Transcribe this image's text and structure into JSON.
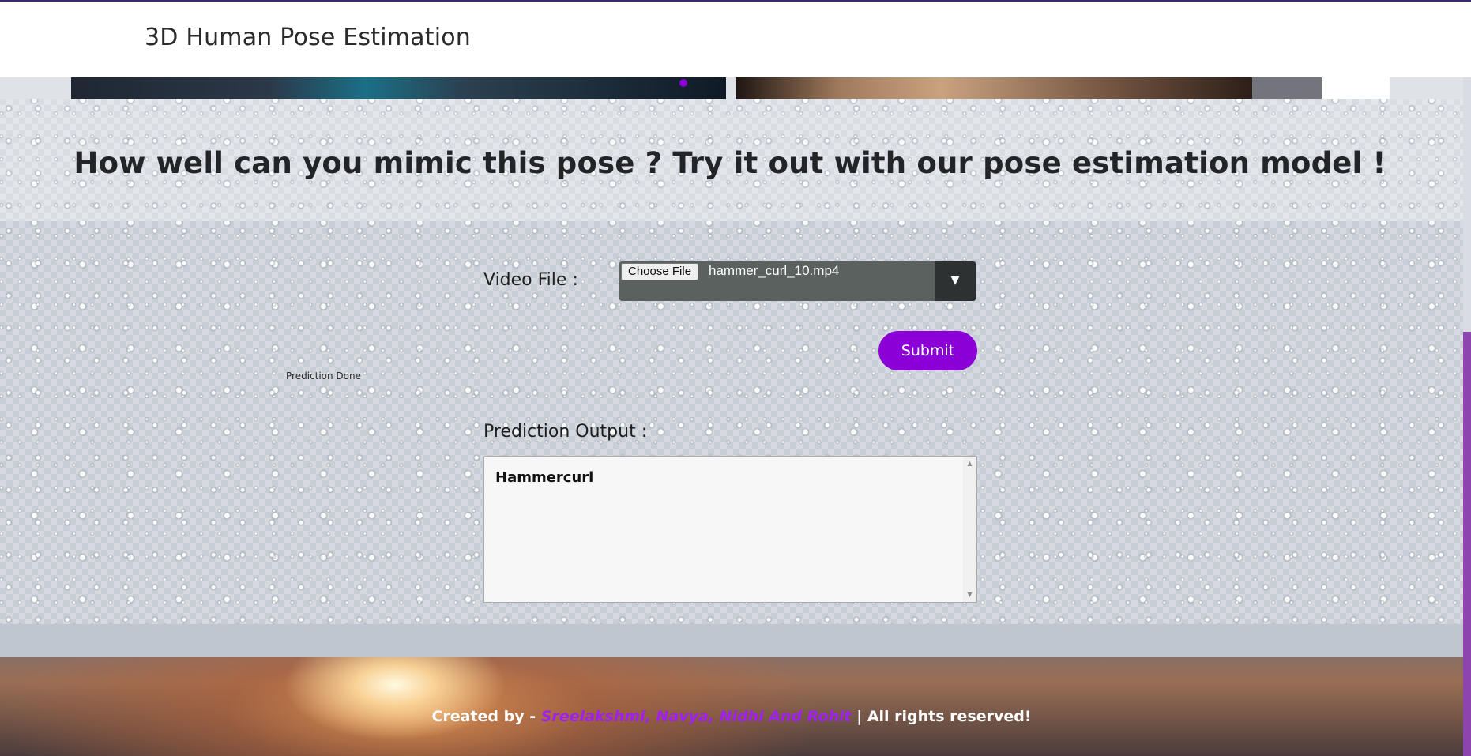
{
  "navbar": {
    "brand": "3D Human Pose Estimation"
  },
  "hero": {
    "title": "How well can you mimic this pose ? Try it out with our pose estimation model !"
  },
  "form": {
    "status": "Prediction Done",
    "video_label": "Video File :",
    "file_button": "Choose File",
    "file_name": "hammer_curl_10.mp4",
    "dropdown_caret": "▼",
    "submit_label": "Submit",
    "output_label": "Prediction Output :",
    "output_value": "Hammercurl"
  },
  "footer": {
    "prefix": "Created by - ",
    "names": "Sreelakshmi, Navya, Nidhi And Rohit",
    "suffix": " | All rights reserved!"
  },
  "colors": {
    "accent": "#8b00d6",
    "footer_names": "#a020f0",
    "scrollbar_thumb": "#8e44ad"
  },
  "icons": {
    "caret": "chevron-down-icon",
    "scroll_up": "scroll-up-icon",
    "scroll_down": "scroll-down-icon"
  }
}
